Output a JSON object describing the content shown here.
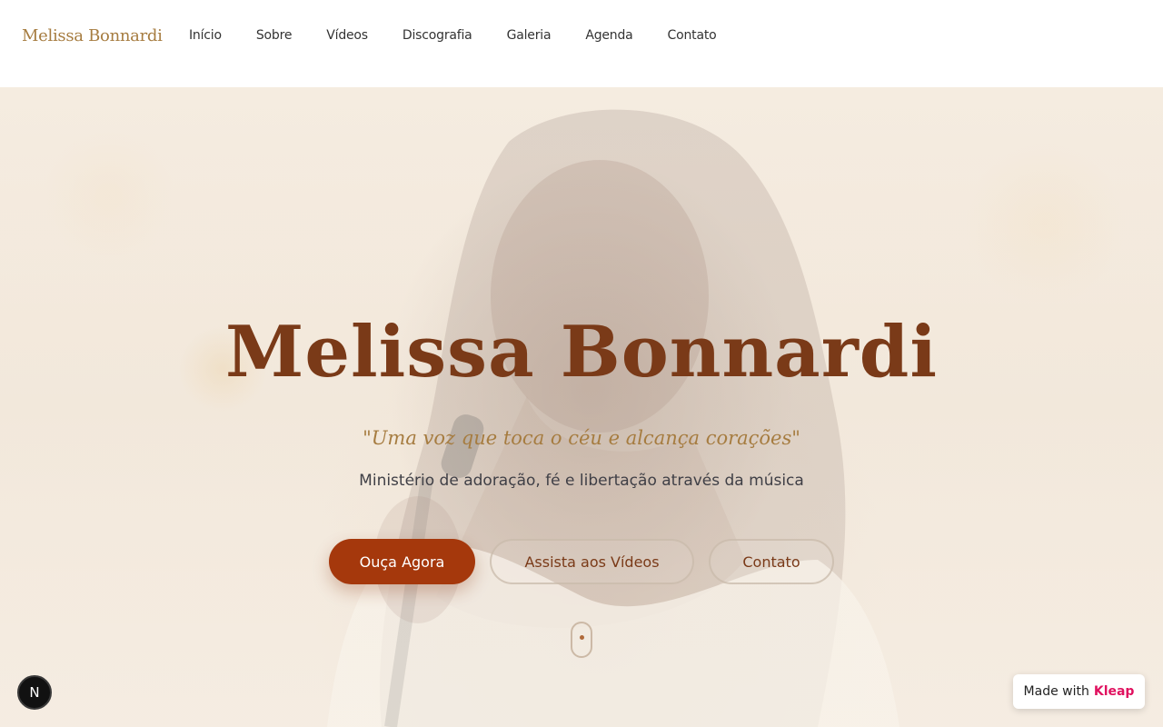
{
  "header": {
    "logo": "Melissa Bonnardi",
    "nav": [
      {
        "label": "Início"
      },
      {
        "label": "Sobre"
      },
      {
        "label": "Vídeos"
      },
      {
        "label": "Discografia"
      },
      {
        "label": "Galeria"
      },
      {
        "label": "Agenda"
      },
      {
        "label": "Contato"
      }
    ]
  },
  "hero": {
    "title": "Melissa Bonnardi",
    "quote": "\"Uma voz que toca o céu e alcança corações\"",
    "subtitle": "Ministério de adoração, fé e libertação através da música",
    "buttons": {
      "primary": "Ouça Agora",
      "videos": "Assista aos Vídeos",
      "contact": "Contato"
    }
  },
  "overlays": {
    "next_badge": "N",
    "made_with_prefix": "Made with",
    "made_with_brand": "Kleap"
  },
  "colors": {
    "accent": "#a5380c",
    "title": "#7a3a18",
    "gold": "#a67c40",
    "kleap": "#e0115f"
  }
}
